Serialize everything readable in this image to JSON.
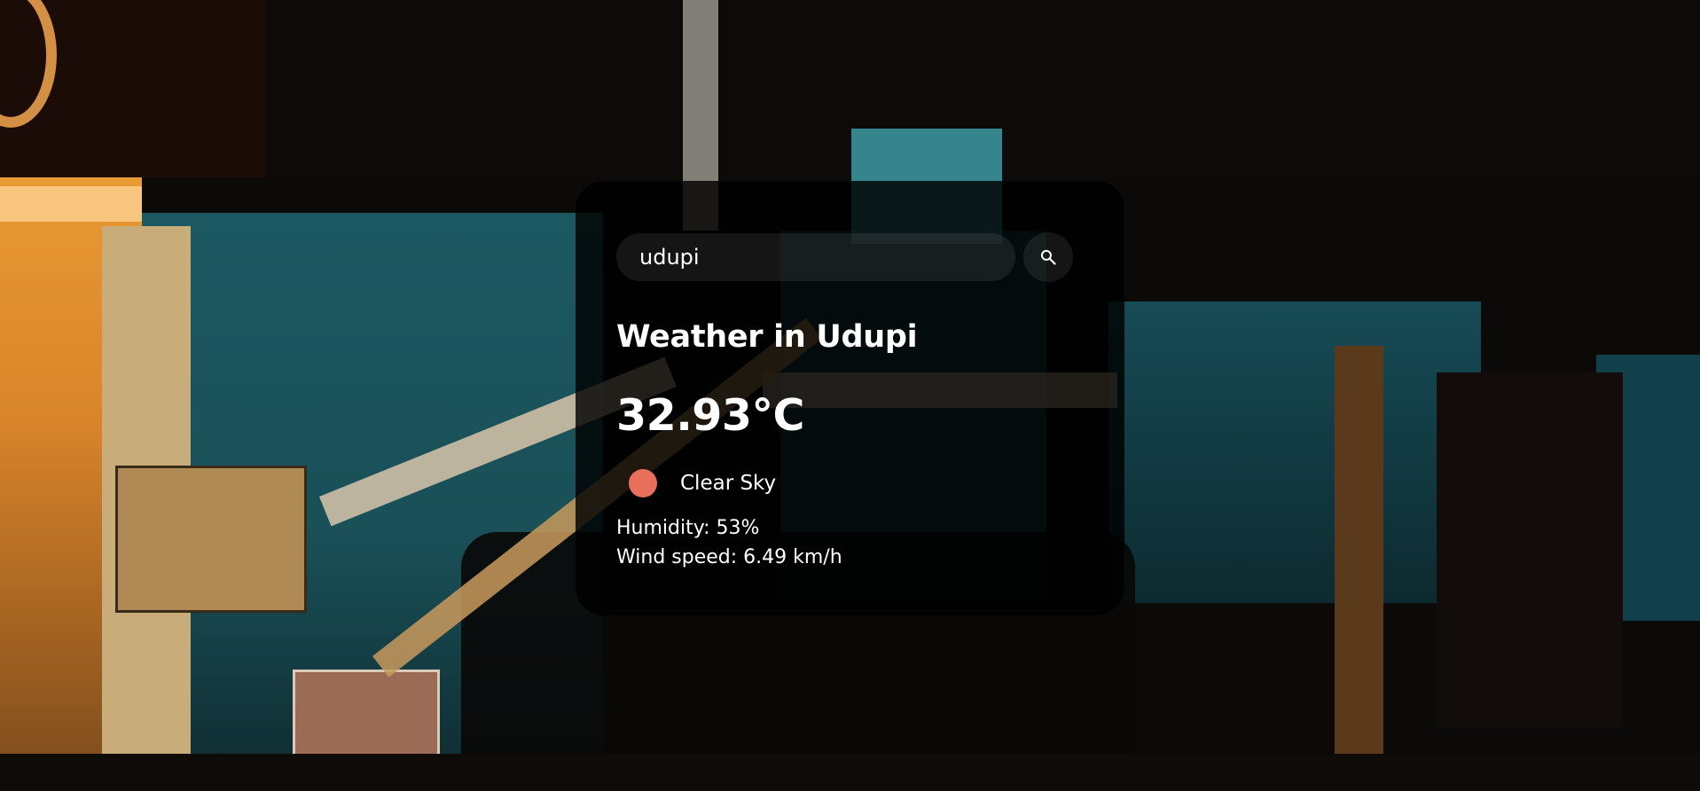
{
  "search": {
    "value": "udupi",
    "button_icon": "search-icon"
  },
  "weather": {
    "title": "Weather in Udupi",
    "temperature": "32.93°C",
    "icon": "clear-sky-sun-icon",
    "icon_color": "#e8705a",
    "description": "Clear Sky",
    "humidity": "Humidity: 53%",
    "wind": "Wind speed: 6.49 km/h"
  },
  "colors": {
    "card_background": "#000000",
    "text": "#ffffff"
  }
}
